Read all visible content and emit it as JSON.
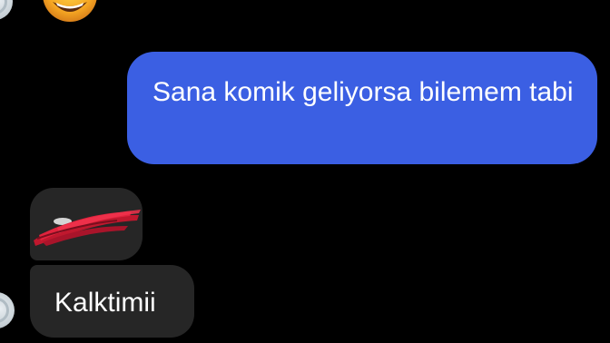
{
  "conversation": {
    "outgoing_message": "Sana komik geliyorsa bilemem tabi",
    "incoming_message": "Kalktimii"
  },
  "colors": {
    "background": "#000000",
    "outgoing_bubble": "#3b5fe3",
    "incoming_bubble": "#262626",
    "text": "#ffffff"
  },
  "icons": {
    "reaction_emoji": "smiling-face-icon",
    "avatar": "contact-avatar-icon",
    "redaction": "red-scribble-redaction"
  }
}
